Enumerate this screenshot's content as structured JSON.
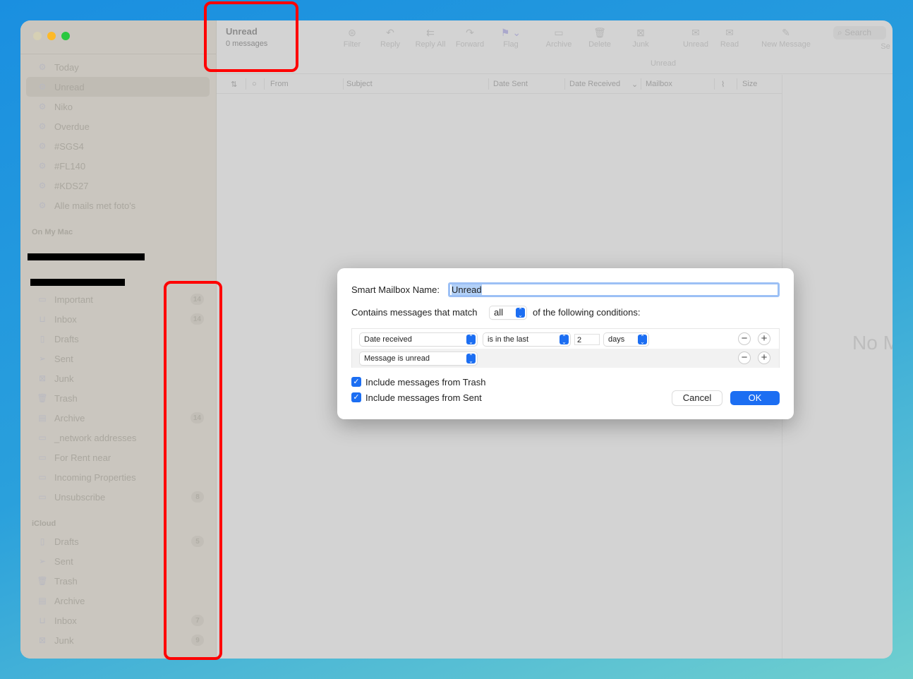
{
  "window": {
    "title": "Unread",
    "subtitle": "0 messages"
  },
  "toolbar": {
    "items": [
      {
        "label": "Filter",
        "icon": "filter-icon",
        "g": "⊜"
      },
      {
        "label": "Reply",
        "icon": "reply-icon",
        "g": "↶"
      },
      {
        "label": "Reply All",
        "icon": "reply-all-icon",
        "g": "⇇"
      },
      {
        "label": "Forward",
        "icon": "forward-icon",
        "g": "↷"
      },
      {
        "label": "Flag",
        "icon": "flag-icon",
        "g": "⚑ ⌄"
      },
      {
        "label": "Archive",
        "icon": "archive-icon",
        "g": "▭"
      },
      {
        "label": "Delete",
        "icon": "trash-icon",
        "g": "🗑"
      },
      {
        "label": "Junk",
        "icon": "junk-icon",
        "g": "⊠"
      },
      {
        "label": "Unread",
        "icon": "unread-icon",
        "g": "✉"
      },
      {
        "label": "Read",
        "icon": "read-icon",
        "g": "✉"
      },
      {
        "label": "New Message",
        "icon": "compose-icon",
        "g": "✎"
      }
    ],
    "search_placeholder": "Search",
    "search_label": "Se",
    "mailbox_label": "Unread"
  },
  "columns": [
    "From",
    "Subject",
    "Date Sent",
    "Date Received",
    "Mailbox",
    "Size"
  ],
  "sidebar": {
    "smart": [
      {
        "label": "Today"
      },
      {
        "label": "Unread",
        "selected": true
      },
      {
        "label": "Niko"
      },
      {
        "label": "Overdue"
      },
      {
        "label": "#SGS4"
      },
      {
        "label": "#FL140"
      },
      {
        "label": "#KDS27"
      },
      {
        "label": "Alle mails met foto's"
      }
    ],
    "on_my_mac_header": "On My Mac",
    "local": [
      {
        "label": "Important",
        "icon": "folder-icon",
        "badge": "14"
      },
      {
        "label": "Inbox",
        "icon": "inbox-icon",
        "badge": "14"
      },
      {
        "label": "Drafts",
        "icon": "document-icon"
      },
      {
        "label": "Sent",
        "icon": "paperplane-icon"
      },
      {
        "label": "Junk",
        "icon": "junk-icon"
      },
      {
        "label": "Trash",
        "icon": "trash-icon"
      },
      {
        "label": "Archive",
        "icon": "archive-icon",
        "badge": "14"
      },
      {
        "label": "_network addresses",
        "icon": "folder-icon"
      },
      {
        "label": "For Rent near",
        "icon": "folder-icon"
      },
      {
        "label": "Incoming Properties",
        "icon": "folder-icon"
      },
      {
        "label": "Unsubscribe",
        "icon": "folder-icon",
        "badge": "8"
      }
    ],
    "icloud_header": "iCloud",
    "icloud": [
      {
        "label": "Drafts",
        "icon": "document-icon",
        "badge": "5"
      },
      {
        "label": "Sent",
        "icon": "paperplane-icon"
      },
      {
        "label": "Trash",
        "icon": "trash-icon"
      },
      {
        "label": "Archive",
        "icon": "archive-icon"
      },
      {
        "label": "Inbox",
        "icon": "inbox-icon",
        "badge": "7"
      },
      {
        "label": "Junk",
        "icon": "junk-icon",
        "badge": "9"
      }
    ]
  },
  "preview": {
    "text": "No M"
  },
  "dialog": {
    "name_label": "Smart Mailbox Name:",
    "name_value": "Unread",
    "match_prefix": "Contains messages that match",
    "match_value": "all",
    "match_suffix": "of the following conditions:",
    "conditions": [
      {
        "field": "Date received",
        "operator": "is in the last",
        "value": "2",
        "unit": "days"
      },
      {
        "field": "Message is unread"
      }
    ],
    "include_trash": {
      "label": "Include messages from Trash",
      "checked": true
    },
    "include_sent": {
      "label": "Include messages from Sent",
      "checked": true
    },
    "cancel": "Cancel",
    "ok": "OK"
  },
  "colors": {
    "accent": "#1c6ef2",
    "annotation": "#ff0000"
  }
}
